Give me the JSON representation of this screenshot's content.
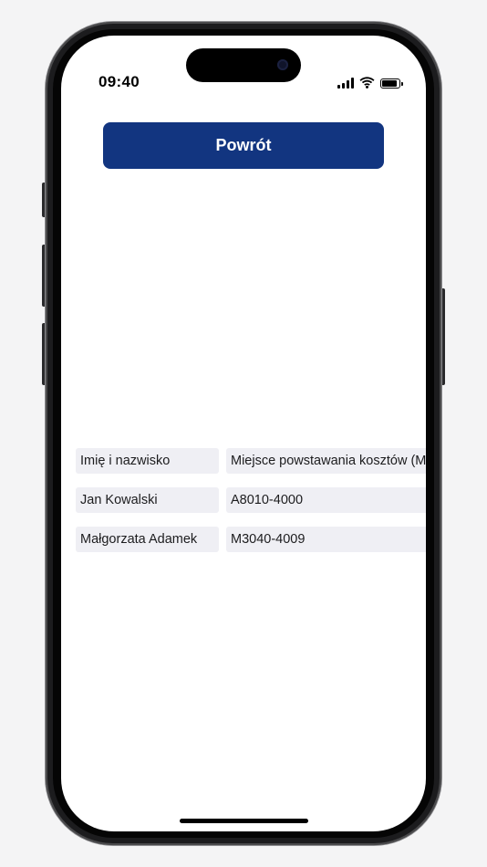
{
  "status_bar": {
    "time": "09:40",
    "signal_icon": "cellular-signal-icon",
    "wifi_icon": "wifi-icon",
    "battery_icon": "battery-icon"
  },
  "actions": {
    "back_label": "Powrót"
  },
  "table": {
    "headers": [
      "Imię i nazwisko",
      "Miejsce powstawania kosztów (MPK)"
    ],
    "rows": [
      [
        "Jan Kowalski",
        "A8010-4000"
      ],
      [
        "Małgorzata Adamek",
        "M3040-4009"
      ]
    ]
  },
  "colors": {
    "primary_button": "#123580",
    "cell_background": "#efeff4",
    "screen_background": "#ffffff"
  }
}
